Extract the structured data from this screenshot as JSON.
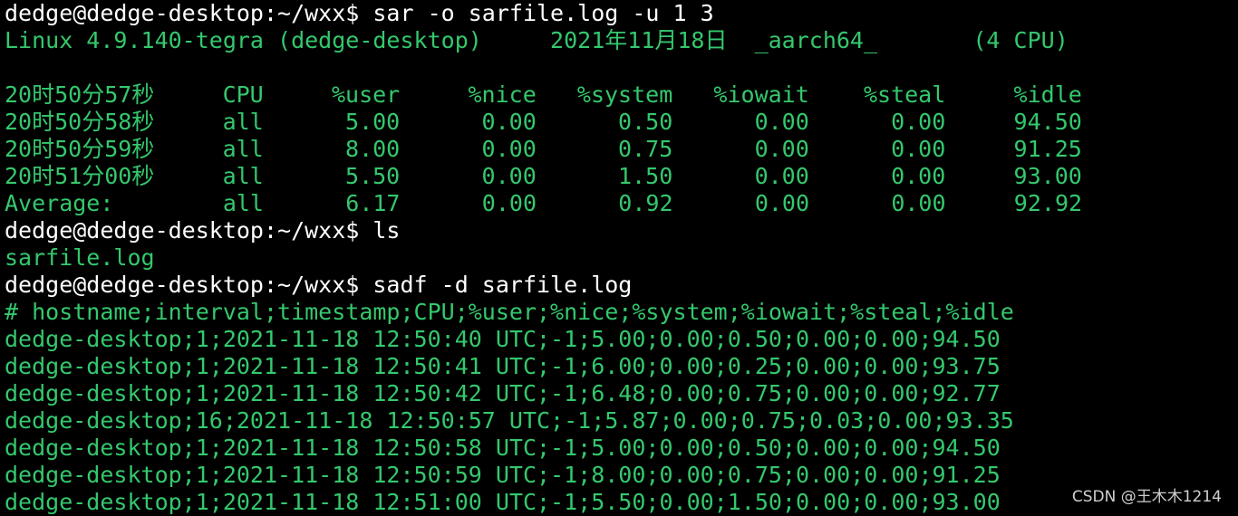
{
  "terminal": {
    "lines": [
      {
        "kind": "prompt",
        "text": "dedge@dedge-desktop:~/wxx$ sar -o sarfile.log -u 1 3"
      },
      {
        "kind": "output",
        "text": "Linux 4.9.140-tegra (dedge-desktop)     2021年11月18日  _aarch64_       (4 CPU)"
      },
      {
        "kind": "blank",
        "text": ""
      },
      {
        "kind": "output",
        "text": "20时50分57秒     CPU     %user     %nice   %system   %iowait    %steal     %idle"
      },
      {
        "kind": "output",
        "text": "20时50分58秒     all      5.00      0.00      0.50      0.00      0.00     94.50"
      },
      {
        "kind": "output",
        "text": "20时50分59秒     all      8.00      0.00      0.75      0.00      0.00     91.25"
      },
      {
        "kind": "output",
        "text": "20时51分00秒     all      5.50      0.00      1.50      0.00      0.00     93.00"
      },
      {
        "kind": "output",
        "text": "Average:        all      6.17      0.00      0.92      0.00      0.00     92.92"
      },
      {
        "kind": "prompt",
        "text": "dedge@dedge-desktop:~/wxx$ ls"
      },
      {
        "kind": "output",
        "text": "sarfile.log"
      },
      {
        "kind": "prompt",
        "text": "dedge@dedge-desktop:~/wxx$ sadf -d sarfile.log"
      },
      {
        "kind": "output",
        "text": "# hostname;interval;timestamp;CPU;%user;%nice;%system;%iowait;%steal;%idle"
      },
      {
        "kind": "output",
        "text": "dedge-desktop;1;2021-11-18 12:50:40 UTC;-1;5.00;0.00;0.50;0.00;0.00;94.50"
      },
      {
        "kind": "output",
        "text": "dedge-desktop;1;2021-11-18 12:50:41 UTC;-1;6.00;0.00;0.25;0.00;0.00;93.75"
      },
      {
        "kind": "output",
        "text": "dedge-desktop;1;2021-11-18 12:50:42 UTC;-1;6.48;0.00;0.75;0.00;0.00;92.77"
      },
      {
        "kind": "output",
        "text": "dedge-desktop;16;2021-11-18 12:50:57 UTC;-1;5.87;0.00;0.75;0.03;0.00;93.35"
      },
      {
        "kind": "output",
        "text": "dedge-desktop;1;2021-11-18 12:50:58 UTC;-1;5.00;0.00;0.50;0.00;0.00;94.50"
      },
      {
        "kind": "output",
        "text": "dedge-desktop;1;2021-11-18 12:50:59 UTC;-1;8.00;0.00;0.75;0.00;0.00;91.25"
      },
      {
        "kind": "output",
        "text": "dedge-desktop;1;2021-11-18 12:51:00 UTC;-1;5.50;0.00;1.50;0.00;0.00;93.00"
      }
    ]
  },
  "watermark": {
    "text": "CSDN @王木木1214"
  },
  "colors": {
    "background": "#000000",
    "prompt_text": "#ffffff",
    "output_text": "#34c86d"
  }
}
